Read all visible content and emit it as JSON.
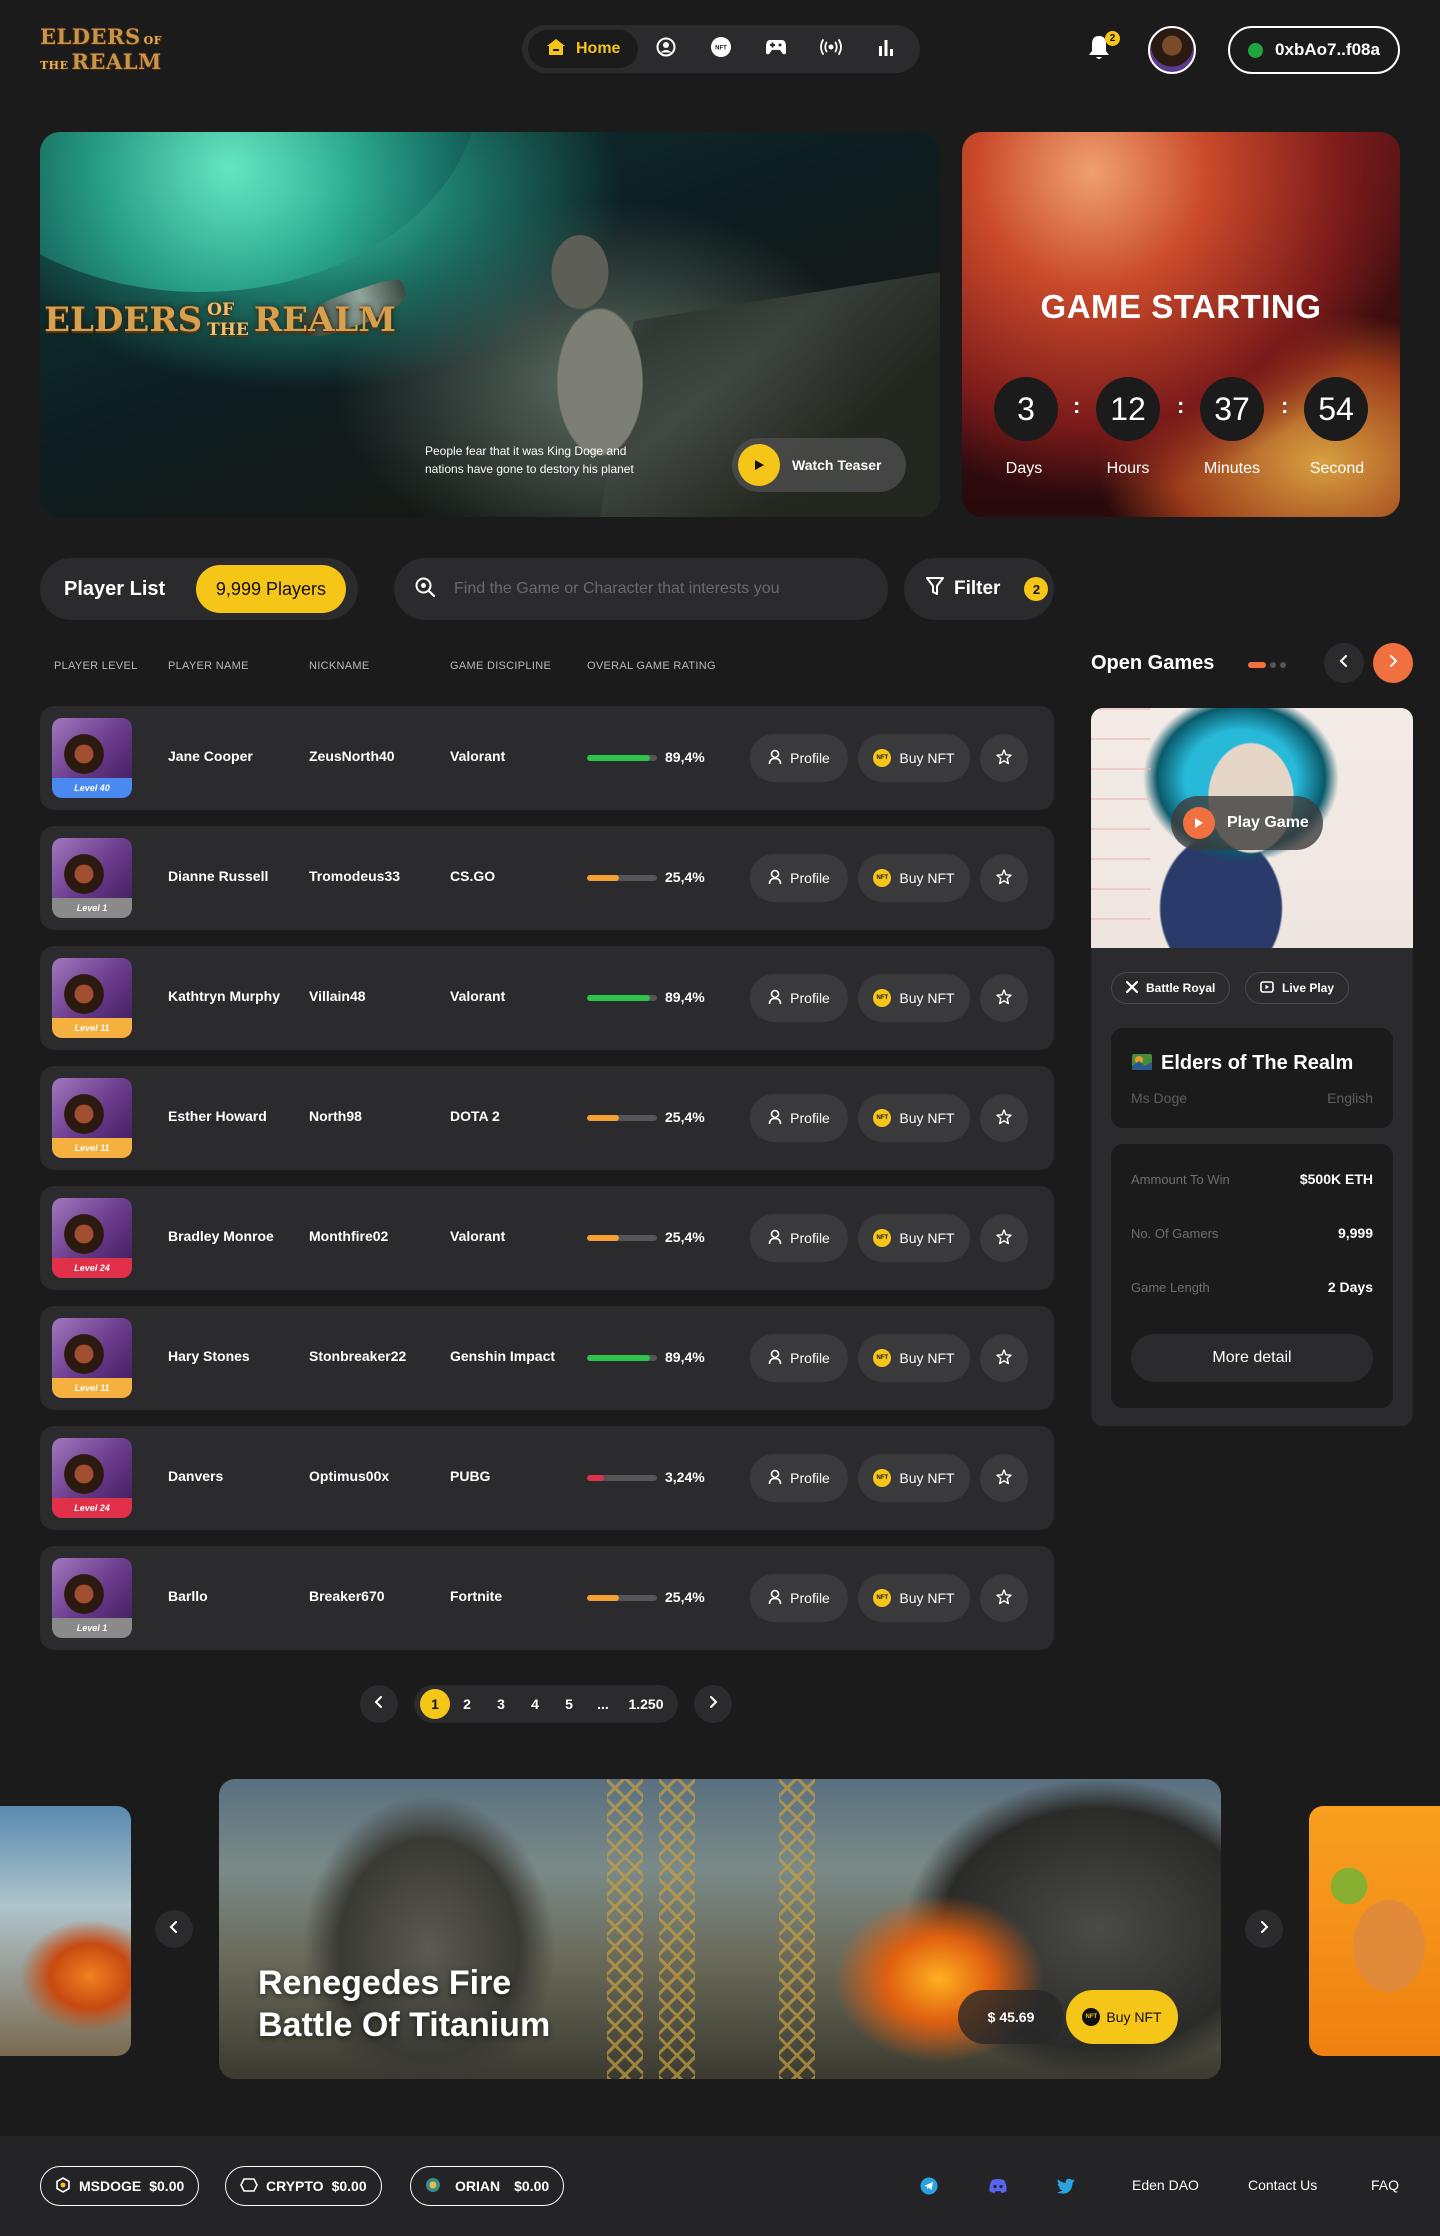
{
  "header": {
    "logo": {
      "word1": "ELDERS",
      "word2": "OF THE",
      "word3": "REALM"
    },
    "nav": {
      "home_label": "Home"
    },
    "notifications_count": "2",
    "wallet_address": "0xbAo7..f08a",
    "colors": {
      "accent": "#f5c518",
      "background": "#1b1b1c",
      "surface": "#2b2b2d",
      "orange": "#f07040"
    }
  },
  "hero": {
    "logo": {
      "word1": "ELDERS",
      "word2": "OF THE",
      "word3": "REALM"
    },
    "description_line1": "People fear that it was King Doge and",
    "description_line2": "nations have gone to destory his planet",
    "teaser_label": "Watch Teaser"
  },
  "countdown": {
    "title": "GAME STARTING",
    "units": [
      {
        "value": "3",
        "label": "Days"
      },
      {
        "value": "12",
        "label": "Hours"
      },
      {
        "value": "37",
        "label": "Minutes"
      },
      {
        "value": "54",
        "label": "Second"
      }
    ]
  },
  "player_list": {
    "title": "Player List",
    "count": "9,999 Players",
    "search_placeholder": "Find the Game or Character that interests you",
    "filter_label": "Filter",
    "filter_count": "2",
    "columns": [
      "PLAYER LEVEL",
      "PLAYER NAME",
      "NICKNAME",
      "GAME DISCIPLINE",
      "OVERAL GAME RATING"
    ],
    "profile_label": "Profile",
    "buy_label": "Buy NFT",
    "nft_icon_text": "NFT",
    "rows": [
      {
        "level": "Level 40",
        "level_color": "#4a8af0",
        "name": "Jane Cooper",
        "nickname": "ZeusNorth40",
        "game": "Valorant",
        "rating": "89,4%",
        "rating_fraction": 0.894,
        "bar_color": "#2ec44a"
      },
      {
        "level": "Level 1",
        "level_color": "#8a8a8a",
        "name": "Dianne Russell",
        "nickname": "Tromodeus33",
        "game": "CS.GO",
        "rating": "25,4%",
        "rating_fraction": 0.45,
        "bar_color": "#f5a030"
      },
      {
        "level": "Level 11",
        "level_color": "#f5b040",
        "name": "Kathtryn Murphy",
        "nickname": "Villain48",
        "game": "Valorant",
        "rating": "89,4%",
        "rating_fraction": 0.894,
        "bar_color": "#2ec44a"
      },
      {
        "level": "Level 11",
        "level_color": "#f5b040",
        "name": "Esther Howard",
        "nickname": "North98",
        "game": "DOTA 2",
        "rating": "25,4%",
        "rating_fraction": 0.45,
        "bar_color": "#f5a030"
      },
      {
        "level": "Level 24",
        "level_color": "#e0304a",
        "name": "Bradley Monroe",
        "nickname": "Monthfire02",
        "game": "Valorant",
        "rating": "25,4%",
        "rating_fraction": 0.45,
        "bar_color": "#f5a030"
      },
      {
        "level": "Level 11",
        "level_color": "#f5b040",
        "name": "Hary Stones",
        "nickname": "Stonbreaker22",
        "game": "Genshin Impact",
        "rating": "89,4%",
        "rating_fraction": 0.894,
        "bar_color": "#2ec44a"
      },
      {
        "level": "Level 24",
        "level_color": "#e0304a",
        "name": "Danvers",
        "nickname": "Optimus00x",
        "game": "PUBG",
        "rating": "3,24%",
        "rating_fraction": 0.24,
        "bar_color": "#e0304a"
      },
      {
        "level": "Level 1",
        "level_color": "#8a8a8a",
        "name": "Barllo",
        "nickname": "Breaker670",
        "game": "Fortnite",
        "rating": "25,4%",
        "rating_fraction": 0.45,
        "bar_color": "#f5a030"
      }
    ]
  },
  "pagination": {
    "pages": [
      "1",
      "2",
      "3",
      "4",
      "5",
      "...",
      "1.250"
    ],
    "current": "1"
  },
  "open_games": {
    "title": "Open Games",
    "play_label": "Play Game",
    "tags": [
      "Battle Royal",
      "Live Play"
    ],
    "game_title": "Elders of The Realm",
    "author": "Ms Doge",
    "language": "English",
    "stats": [
      {
        "label": "Ammount To Win",
        "value": "$500K ETH"
      },
      {
        "label": "No. Of Gamers",
        "value": "9,999"
      },
      {
        "label": "Game Length",
        "value": "2 Days"
      }
    ],
    "more_label": "More detail"
  },
  "carousel": {
    "title_line1": "Renegedes Fire",
    "title_line2": "Battle Of Titanium",
    "price": "$ 45.69",
    "buy_label": "Buy NFT"
  },
  "footer": {
    "coins": [
      {
        "name": "MSDOGE",
        "value": "$0.00"
      },
      {
        "name": "CRYPTO",
        "value": "$0.00"
      },
      {
        "name": "ORIAN",
        "value": "$0.00"
      }
    ],
    "links": [
      "Eden DAO",
      "Contact Us",
      "FAQ"
    ],
    "social_icons": [
      "telegram-icon",
      "discord-icon",
      "twitter-icon"
    ]
  }
}
